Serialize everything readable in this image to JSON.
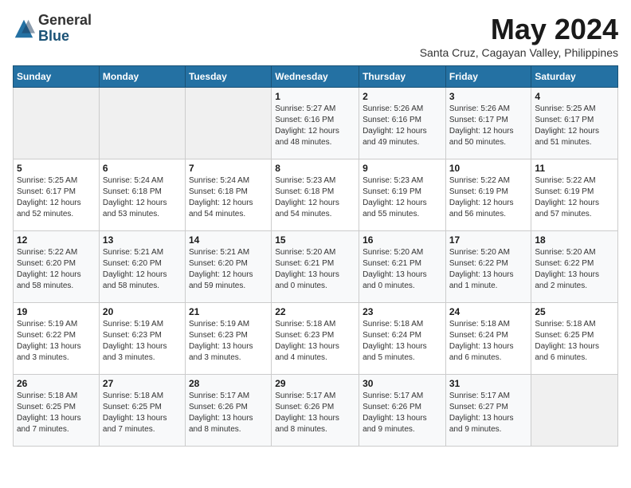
{
  "logo": {
    "general": "General",
    "blue": "Blue"
  },
  "title": "May 2024",
  "subtitle": "Santa Cruz, Cagayan Valley, Philippines",
  "days_of_week": [
    "Sunday",
    "Monday",
    "Tuesday",
    "Wednesday",
    "Thursday",
    "Friday",
    "Saturday"
  ],
  "weeks": [
    [
      {
        "day": "",
        "info": ""
      },
      {
        "day": "",
        "info": ""
      },
      {
        "day": "",
        "info": ""
      },
      {
        "day": "1",
        "info": "Sunrise: 5:27 AM\nSunset: 6:16 PM\nDaylight: 12 hours\nand 48 minutes."
      },
      {
        "day": "2",
        "info": "Sunrise: 5:26 AM\nSunset: 6:16 PM\nDaylight: 12 hours\nand 49 minutes."
      },
      {
        "day": "3",
        "info": "Sunrise: 5:26 AM\nSunset: 6:17 PM\nDaylight: 12 hours\nand 50 minutes."
      },
      {
        "day": "4",
        "info": "Sunrise: 5:25 AM\nSunset: 6:17 PM\nDaylight: 12 hours\nand 51 minutes."
      }
    ],
    [
      {
        "day": "5",
        "info": "Sunrise: 5:25 AM\nSunset: 6:17 PM\nDaylight: 12 hours\nand 52 minutes."
      },
      {
        "day": "6",
        "info": "Sunrise: 5:24 AM\nSunset: 6:18 PM\nDaylight: 12 hours\nand 53 minutes."
      },
      {
        "day": "7",
        "info": "Sunrise: 5:24 AM\nSunset: 6:18 PM\nDaylight: 12 hours\nand 54 minutes."
      },
      {
        "day": "8",
        "info": "Sunrise: 5:23 AM\nSunset: 6:18 PM\nDaylight: 12 hours\nand 54 minutes."
      },
      {
        "day": "9",
        "info": "Sunrise: 5:23 AM\nSunset: 6:19 PM\nDaylight: 12 hours\nand 55 minutes."
      },
      {
        "day": "10",
        "info": "Sunrise: 5:22 AM\nSunset: 6:19 PM\nDaylight: 12 hours\nand 56 minutes."
      },
      {
        "day": "11",
        "info": "Sunrise: 5:22 AM\nSunset: 6:19 PM\nDaylight: 12 hours\nand 57 minutes."
      }
    ],
    [
      {
        "day": "12",
        "info": "Sunrise: 5:22 AM\nSunset: 6:20 PM\nDaylight: 12 hours\nand 58 minutes."
      },
      {
        "day": "13",
        "info": "Sunrise: 5:21 AM\nSunset: 6:20 PM\nDaylight: 12 hours\nand 58 minutes."
      },
      {
        "day": "14",
        "info": "Sunrise: 5:21 AM\nSunset: 6:20 PM\nDaylight: 12 hours\nand 59 minutes."
      },
      {
        "day": "15",
        "info": "Sunrise: 5:20 AM\nSunset: 6:21 PM\nDaylight: 13 hours\nand 0 minutes."
      },
      {
        "day": "16",
        "info": "Sunrise: 5:20 AM\nSunset: 6:21 PM\nDaylight: 13 hours\nand 0 minutes."
      },
      {
        "day": "17",
        "info": "Sunrise: 5:20 AM\nSunset: 6:22 PM\nDaylight: 13 hours\nand 1 minute."
      },
      {
        "day": "18",
        "info": "Sunrise: 5:20 AM\nSunset: 6:22 PM\nDaylight: 13 hours\nand 2 minutes."
      }
    ],
    [
      {
        "day": "19",
        "info": "Sunrise: 5:19 AM\nSunset: 6:22 PM\nDaylight: 13 hours\nand 3 minutes."
      },
      {
        "day": "20",
        "info": "Sunrise: 5:19 AM\nSunset: 6:23 PM\nDaylight: 13 hours\nand 3 minutes."
      },
      {
        "day": "21",
        "info": "Sunrise: 5:19 AM\nSunset: 6:23 PM\nDaylight: 13 hours\nand 3 minutes."
      },
      {
        "day": "22",
        "info": "Sunrise: 5:18 AM\nSunset: 6:23 PM\nDaylight: 13 hours\nand 4 minutes."
      },
      {
        "day": "23",
        "info": "Sunrise: 5:18 AM\nSunset: 6:24 PM\nDaylight: 13 hours\nand 5 minutes."
      },
      {
        "day": "24",
        "info": "Sunrise: 5:18 AM\nSunset: 6:24 PM\nDaylight: 13 hours\nand 6 minutes."
      },
      {
        "day": "25",
        "info": "Sunrise: 5:18 AM\nSunset: 6:25 PM\nDaylight: 13 hours\nand 6 minutes."
      }
    ],
    [
      {
        "day": "26",
        "info": "Sunrise: 5:18 AM\nSunset: 6:25 PM\nDaylight: 13 hours\nand 7 minutes."
      },
      {
        "day": "27",
        "info": "Sunrise: 5:18 AM\nSunset: 6:25 PM\nDaylight: 13 hours\nand 7 minutes."
      },
      {
        "day": "28",
        "info": "Sunrise: 5:17 AM\nSunset: 6:26 PM\nDaylight: 13 hours\nand 8 minutes."
      },
      {
        "day": "29",
        "info": "Sunrise: 5:17 AM\nSunset: 6:26 PM\nDaylight: 13 hours\nand 8 minutes."
      },
      {
        "day": "30",
        "info": "Sunrise: 5:17 AM\nSunset: 6:26 PM\nDaylight: 13 hours\nand 9 minutes."
      },
      {
        "day": "31",
        "info": "Sunrise: 5:17 AM\nSunset: 6:27 PM\nDaylight: 13 hours\nand 9 minutes."
      },
      {
        "day": "",
        "info": ""
      }
    ]
  ]
}
